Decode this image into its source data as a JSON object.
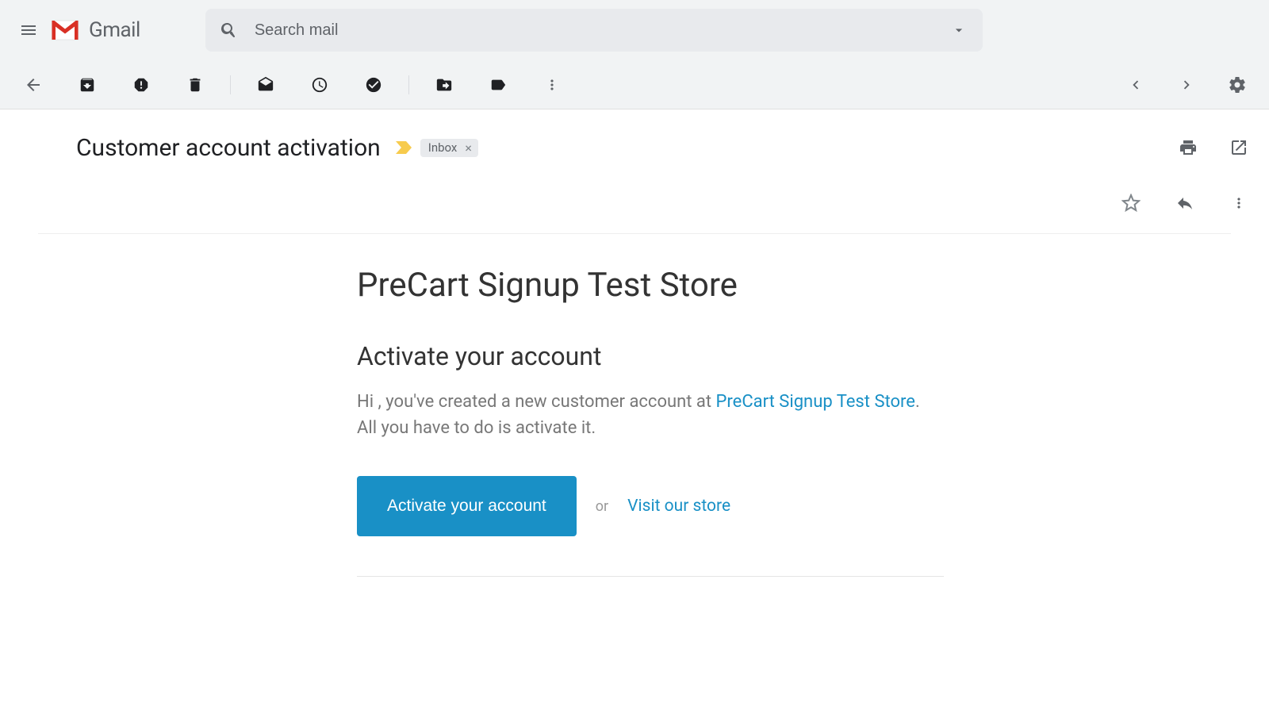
{
  "header": {
    "app_name": "Gmail",
    "search": {
      "placeholder": "Search mail"
    }
  },
  "email": {
    "subject": "Customer account activation",
    "label": "Inbox",
    "body": {
      "store_name": "PreCart Signup Test Store",
      "heading": "Activate your account",
      "greeting_prefix": "Hi , you've created a new customer account at ",
      "store_link_text": "PreCart Signup Test Store",
      "greeting_suffix": ". All you have to do is activate it.",
      "activate_button": "Activate your account",
      "or_text": "or",
      "visit_link": "Visit our store"
    }
  }
}
